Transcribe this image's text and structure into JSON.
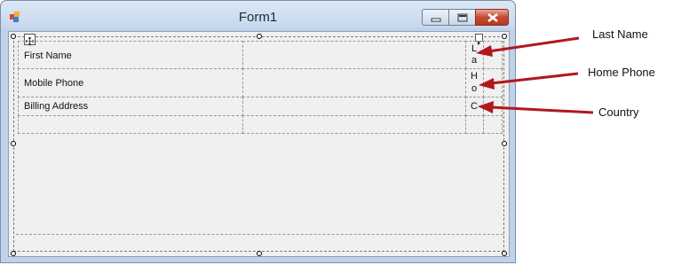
{
  "window": {
    "title": "Form1",
    "controls": [
      "minimize-icon",
      "maximize-icon",
      "close-icon"
    ]
  },
  "table": {
    "rows": [
      {
        "label": "First Name"
      },
      {
        "label": "Mobile Phone"
      },
      {
        "label": "Billing Address"
      },
      {
        "label": ""
      }
    ],
    "narrow_column_text": [
      "L",
      "a",
      "H",
      "o",
      "C"
    ]
  },
  "annotations": {
    "last_name": "Last Name",
    "home_phone": "Home Phone",
    "country": "Country"
  },
  "colors": {
    "arrow": "#b3161d",
    "client_bg": "#f0f0f0",
    "title_bar": "#c7d8ee"
  }
}
